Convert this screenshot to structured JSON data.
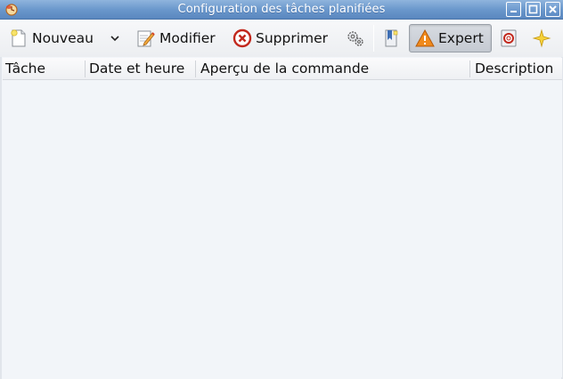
{
  "window": {
    "title": "Configuration des tâches planifiées"
  },
  "toolbar": {
    "new_label": "Nouveau",
    "modify_label": "Modifier",
    "delete_label": "Supprimer",
    "expert_label": "Expert"
  },
  "table": {
    "columns": [
      "Tâche",
      "Date et heure",
      "Aperçu de la commande",
      "Description"
    ],
    "rows": []
  },
  "colors": {
    "titlebar": "#6b98cc",
    "background": "#f2f5f9",
    "expert_pressed": "#c5cad2"
  }
}
